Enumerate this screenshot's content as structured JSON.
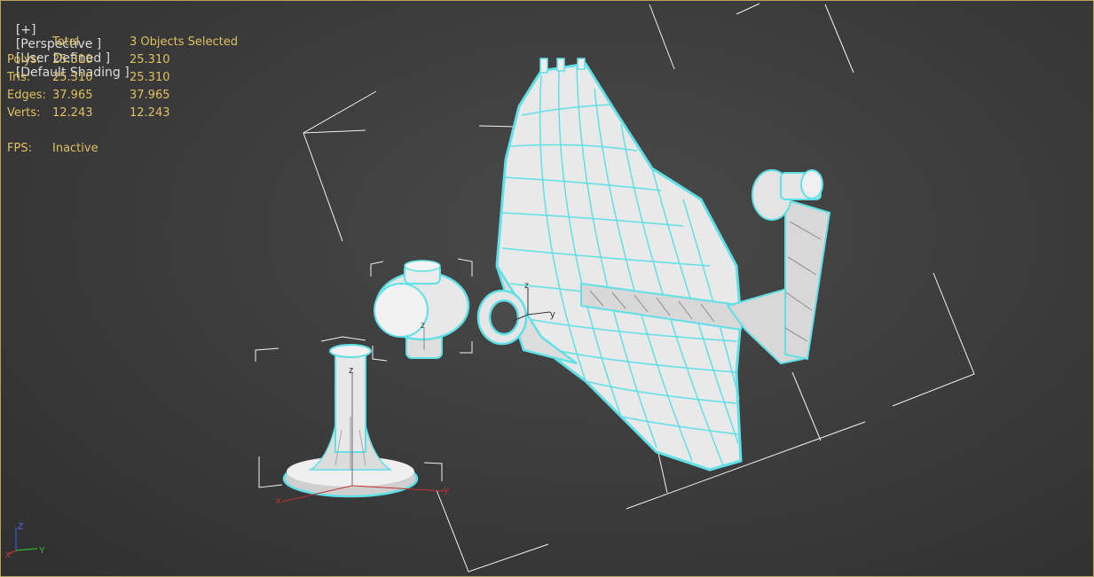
{
  "viewport": {
    "label": {
      "plus": "[+]",
      "view": "[Perspective ]",
      "camera": "[User Defined ]",
      "shading": "[Default Shading ]"
    },
    "stats": {
      "header_total": "Total",
      "header_selected": "3 Objects Selected",
      "rows": [
        {
          "name": "Polys:",
          "total": "25.310",
          "selected": "25.310"
        },
        {
          "name": "Tris:",
          "total": "25.310",
          "selected": "25.310"
        },
        {
          "name": "Edges:",
          "total": "37.965",
          "selected": "37.965"
        },
        {
          "name": "Verts:",
          "total": "12.243",
          "selected": "12.243"
        }
      ],
      "fps_label": "FPS:",
      "fps_value": "Inactive"
    },
    "gizmo_axes": {
      "z": "Z",
      "y": "Y",
      "x": "X"
    },
    "pivot_axes": {
      "z": "z",
      "y": "y",
      "x": "x"
    },
    "colors": {
      "stats_text": "#e0c060",
      "selection_outline": "#5fe0e6",
      "object_fill": "#e6e6e6",
      "axis_x": "#c03030",
      "axis_y": "#30a030",
      "axis_z": "#3050c0"
    }
  }
}
